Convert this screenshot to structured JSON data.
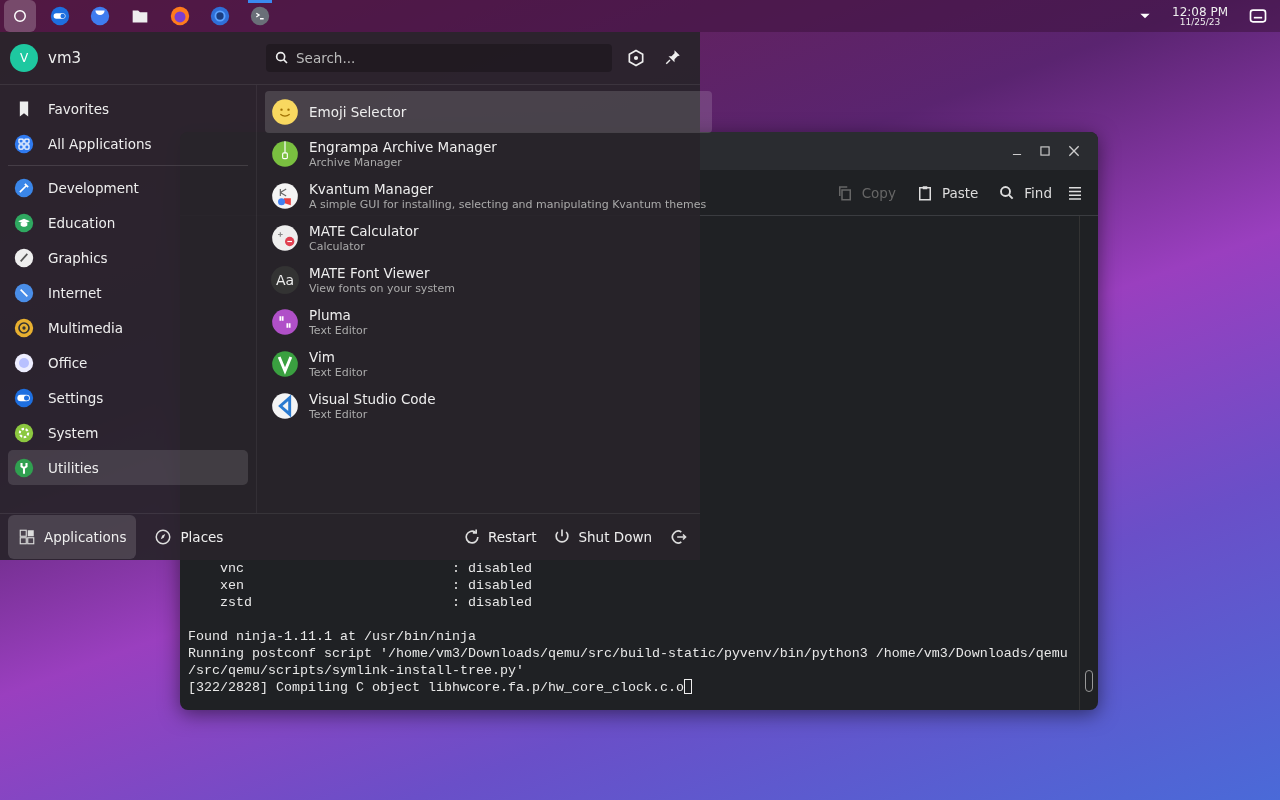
{
  "taskbar": {
    "launcher": {
      "selected": true
    },
    "apps": [
      {
        "kind": "toggle",
        "active": false
      },
      {
        "kind": "bubble",
        "active": false
      },
      {
        "kind": "folder",
        "active": false
      },
      {
        "kind": "fox",
        "active": false
      },
      {
        "kind": "ring",
        "active": false
      },
      {
        "kind": "terminal",
        "active": true
      }
    ],
    "tray": {
      "time": "12:08 PM",
      "date": "11/25/23"
    }
  },
  "menu": {
    "user": {
      "initial": "V",
      "name": "vm3"
    },
    "search": {
      "placeholder": "Search..."
    },
    "places": [
      {
        "label": "Favorites",
        "kind": "bookmark",
        "selected": false
      },
      {
        "label": "All Applications",
        "kind": "grid",
        "selected": false
      }
    ],
    "categories": [
      {
        "label": "Development",
        "kind": "dev",
        "selected": false
      },
      {
        "label": "Education",
        "kind": "edu",
        "selected": false
      },
      {
        "label": "Graphics",
        "kind": "graphics",
        "selected": false
      },
      {
        "label": "Internet",
        "kind": "internet",
        "selected": false
      },
      {
        "label": "Multimedia",
        "kind": "media",
        "selected": false
      },
      {
        "label": "Office",
        "kind": "office",
        "selected": false
      },
      {
        "label": "Settings",
        "kind": "settings",
        "selected": false
      },
      {
        "label": "System",
        "kind": "system",
        "selected": false
      },
      {
        "label": "Utilities",
        "kind": "utilities",
        "selected": true
      }
    ],
    "apps": [
      {
        "name": "Emoji Selector",
        "kind": "emoji",
        "selected": true
      },
      {
        "name": "Engrampa Archive Manager",
        "description": "Archive Manager",
        "kind": "archive",
        "selected": false
      },
      {
        "name": "Kvantum Manager",
        "description": "A simple GUI for installing, selecting and manipulating Kvantum themes",
        "kind": "kvantum",
        "selected": false
      },
      {
        "name": "MATE Calculator",
        "description": "Calculator",
        "kind": "calc",
        "selected": false
      },
      {
        "name": "MATE Font Viewer",
        "description": "View fonts on your system",
        "kind": "font",
        "glyph": "Aa",
        "selected": false
      },
      {
        "name": "Pluma",
        "description": "Text Editor",
        "kind": "pluma",
        "selected": false
      },
      {
        "name": "Vim",
        "description": "Text Editor",
        "kind": "vim",
        "selected": false
      },
      {
        "name": "Visual Studio Code",
        "description": "Text Editor",
        "kind": "code",
        "selected": false
      }
    ],
    "footer_tabs": [
      {
        "label": "Applications",
        "kind": "grid",
        "selected": true
      },
      {
        "label": "Places",
        "kind": "compass",
        "selected": false
      }
    ],
    "actions": [
      {
        "label": "Restart",
        "kind": "restart"
      },
      {
        "label": "Shut Down",
        "kind": "power"
      },
      {
        "kind": "logout"
      }
    ]
  },
  "terminal": {
    "toolbar": [
      {
        "label": "Copy",
        "kind": "copy",
        "disabled": true
      },
      {
        "label": "Paste",
        "kind": "paste",
        "disabled": false
      },
      {
        "label": "Find",
        "kind": "find",
        "disabled": false
      }
    ],
    "blocks": [
      [
        "    vnc                          : disabled",
        "    xen                          : disabled",
        "    zstd                         : disabled"
      ],
      [
        "Found ninja-1.11.1 at /usr/bin/ninja",
        "Running postconf script '/home/vm3/Downloads/qemu/src/build-static/pyvenv/bin/python3 /home/vm3/Downloads/qemu",
        "/src/qemu/scripts/symlink-install-tree.py'",
        "[322/2828] Compiling C object libhwcore.fa.p/hw_core_clock.c.o"
      ]
    ],
    "cursor": true
  }
}
